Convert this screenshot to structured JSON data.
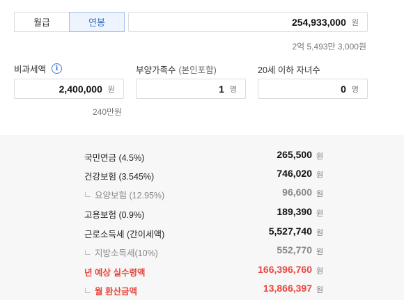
{
  "toggle": {
    "monthly": "월급",
    "yearly": "연봉",
    "selected": "yearly"
  },
  "salary": {
    "value": "254,933,000",
    "unit": "원",
    "korean": "2억 5,493만 3,000원"
  },
  "nontax": {
    "label": "비과세액",
    "info": "i",
    "value": "2,400,000",
    "unit": "원",
    "korean": "240만원"
  },
  "dependents": {
    "label": "부양가족수",
    "sub": "(본인포함)",
    "value": "1",
    "unit": "명"
  },
  "children": {
    "label": "20세 이하 자녀수",
    "value": "0",
    "unit": "명"
  },
  "results": [
    {
      "name": "국민연금 (4.5%)",
      "value": "265,500",
      "unit": "원"
    },
    {
      "name": "건강보험 (3.545%)",
      "value": "746,020",
      "unit": "원"
    },
    {
      "name": "요양보험 (12.95%)",
      "value": "96,600",
      "unit": "원"
    },
    {
      "name": "고용보험 (0.9%)",
      "value": "189,390",
      "unit": "원"
    },
    {
      "name": "근로소득세 (간이세액)",
      "value": "5,527,740",
      "unit": "원"
    },
    {
      "name": "지방소득세(10%)",
      "value": "552,770",
      "unit": "원"
    },
    {
      "name": "년 예상 실수령액",
      "value": "166,396,760",
      "unit": "원"
    },
    {
      "name": "월 환산금액",
      "value": "13,866,397",
      "unit": "원"
    }
  ],
  "colors": {
    "accent": "#2f6dc6",
    "highlight": "#e8473f",
    "muted": "#888888"
  }
}
